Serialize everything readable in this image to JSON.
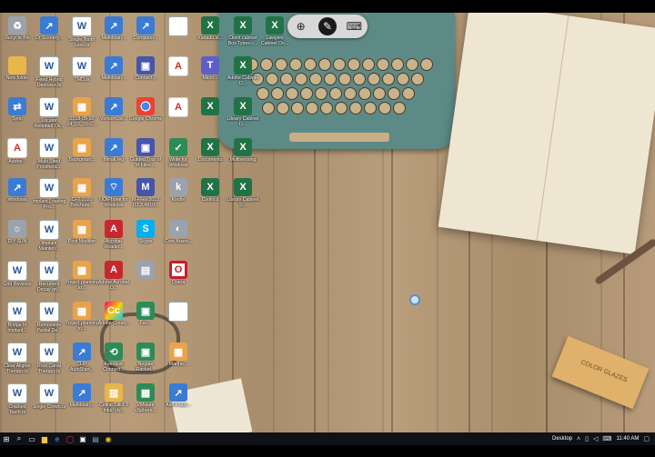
{
  "magnifier": {
    "zoom_icon": "zoom-in-icon",
    "active_icon": "magnifier-mode-icon",
    "keyboard_icon": "keyboard-icon"
  },
  "taskbar": {
    "desktop_label": "Desktop",
    "time": "11:40 AM"
  },
  "desktop_icons": [
    {
      "label": "Recycle Bin",
      "kind": "g-gray",
      "glyph": "♻"
    },
    {
      "label": "Dr Scenery...",
      "kind": "g-link",
      "glyph": "↗"
    },
    {
      "label": "Single Tooth Loss.ts",
      "kind": "g-doc",
      "glyph": "W"
    },
    {
      "label": "Meltdown...",
      "kind": "g-link",
      "glyph": "↗"
    },
    {
      "label": "Computer...",
      "kind": "g-link",
      "glyph": "↗"
    },
    {
      "label": "",
      "kind": "g-doc",
      "glyph": ""
    },
    {
      "label": "Xanadu.xl...",
      "kind": "g-xls",
      "glyph": "X"
    },
    {
      "label": "Client cabinet Box Types c...",
      "kind": "g-xls",
      "glyph": "X"
    },
    {
      "label": "Lawyers Cabinet Do...",
      "kind": "g-xls",
      "glyph": "X"
    },
    {
      "label": "New folder",
      "kind": "g-folder",
      "glyph": ""
    },
    {
      "label": "Fixed Hybrid Dentures.ts",
      "kind": "g-doc",
      "glyph": "W"
    },
    {
      "label": "TMD.ts",
      "kind": "g-doc",
      "glyph": "W"
    },
    {
      "label": "Meltdown...",
      "kind": "g-link",
      "glyph": "↗"
    },
    {
      "label": "Connect...",
      "kind": "g-app",
      "glyph": "▣"
    },
    {
      "label": "",
      "kind": "g-pdf",
      "glyph": "A"
    },
    {
      "label": "Micro...",
      "kind": "g-teams",
      "glyph": "T"
    },
    {
      "label": "Adobe Cabinet D...",
      "kind": "g-xls",
      "glyph": "X"
    },
    {
      "label": "Sync",
      "kind": "g-link",
      "glyph": "⇄"
    },
    {
      "label": "Locator Retained Ov...",
      "kind": "g-doc",
      "glyph": "W"
    },
    {
      "label": "2018-05-10 14_22_20-C...",
      "kind": "g-img",
      "glyph": "▦"
    },
    {
      "label": "VersionList...",
      "kind": "g-link",
      "glyph": "↗"
    },
    {
      "label": "Google Chrome",
      "kind": "g-chrome",
      "glyph": ""
    },
    {
      "label": "",
      "kind": "g-pdf",
      "glyph": "A"
    },
    {
      "label": "",
      "kind": "g-xls",
      "glyph": "X"
    },
    {
      "label": "Library Cabinet D...",
      "kind": "g-xls",
      "glyph": "X"
    },
    {
      "label": "Adobe...",
      "kind": "g-pdf",
      "glyph": "A"
    },
    {
      "label": "Multi Sited Prosthetic...",
      "kind": "g-doc",
      "glyph": "W"
    },
    {
      "label": "Backgroun...",
      "kind": "g-img",
      "glyph": "▦"
    },
    {
      "label": "filmail.reg",
      "kind": "g-link",
      "glyph": "↗"
    },
    {
      "label": "Guided Tour of M-Files ...",
      "kind": "g-app",
      "glyph": "▣"
    },
    {
      "label": "Write for Windows",
      "kind": "g-green",
      "glyph": "✓"
    },
    {
      "label": "Documents",
      "kind": "g-xls",
      "glyph": "X"
    },
    {
      "label": "Multisensing",
      "kind": "g-xls",
      "glyph": "X"
    },
    {
      "label": "Windows",
      "kind": "g-link",
      "glyph": "↗"
    },
    {
      "label": "Implant Loading Pro...",
      "kind": "g-doc",
      "glyph": "W"
    },
    {
      "label": "CFT 2020 Brochure...",
      "kind": "g-img",
      "glyph": "▦"
    },
    {
      "label": "NOIPhone for Windows",
      "kind": "g-link",
      "glyph": "⌔"
    },
    {
      "label": "M-Files 2018 (11.3.4810...",
      "kind": "g-app",
      "glyph": "M"
    },
    {
      "label": "Kindle",
      "kind": "g-gray",
      "glyph": "k"
    },
    {
      "label": "Coolio.x",
      "kind": "g-xls",
      "glyph": "X"
    },
    {
      "label": "Library Cabinet S...",
      "kind": "g-xls",
      "glyph": "X"
    },
    {
      "label": "DIY-SUN",
      "kind": "g-gray",
      "glyph": "☼"
    },
    {
      "label": "Implant Mainten...",
      "kind": "g-doc",
      "glyph": "W"
    },
    {
      "label": "Post Modifier",
      "kind": "g-img",
      "glyph": "▦"
    },
    {
      "label": "Acrobat Reader...",
      "kind": "g-red",
      "glyph": "A"
    },
    {
      "label": "Skype",
      "kind": "g-sky",
      "glyph": "S"
    },
    {
      "label": "Core Arsen...",
      "kind": "g-gray",
      "glyph": "◐"
    },
    {
      "label": "Grid Revision",
      "kind": "g-doc",
      "glyph": "W"
    },
    {
      "label": "Recurrent Decay an...",
      "kind": "g-doc",
      "glyph": "W"
    },
    {
      "label": "Project planning to...",
      "kind": "g-img",
      "glyph": "▦"
    },
    {
      "label": "Adobe Acrobat D...",
      "kind": "g-red",
      "glyph": "A"
    },
    {
      "label": "",
      "kind": "g-gray",
      "glyph": "▤"
    },
    {
      "label": "Opera",
      "kind": "g-opera",
      "glyph": "O"
    },
    {
      "label": "Bridge to Implant...",
      "kind": "g-doc",
      "glyph": "W"
    },
    {
      "label": "Removable Partial De...",
      "kind": "g-doc",
      "glyph": "W"
    },
    {
      "label": "Project planning to...",
      "kind": "g-img",
      "glyph": "▦"
    },
    {
      "label": "Adobe Creati...",
      "kind": "g-multi",
      "glyph": "Cc"
    },
    {
      "label": "Fax...",
      "kind": "g-green",
      "glyph": "▣"
    },
    {
      "label": "",
      "kind": "g-doc",
      "glyph": ""
    },
    {
      "label": "Clear Aligner Therapy.ts",
      "kind": "g-doc",
      "glyph": "W"
    },
    {
      "label": "Root Canal Therapy.ts",
      "kind": "g-doc",
      "glyph": "W"
    },
    {
      "label": "CLIP AutoStart...",
      "kind": "g-link",
      "glyph": "↗"
    },
    {
      "label": "Autodesk Connect...",
      "kind": "g-green",
      "glyph": "⟲"
    },
    {
      "label": "Negate Racket...",
      "kind": "g-green",
      "glyph": "▣"
    },
    {
      "label": "Marthe...",
      "kind": "g-img",
      "glyph": "▦"
    },
    {
      "label": "Cracked Teeth.ts",
      "kind": "g-doc",
      "glyph": "W"
    },
    {
      "label": "Single Crown.ts",
      "kind": "g-doc",
      "glyph": "W"
    },
    {
      "label": "Meltdown...",
      "kind": "g-link",
      "glyph": "↗"
    },
    {
      "label": "Celine Silicr 3 Intuit Hy...",
      "kind": "g-folder",
      "glyph": "▥"
    },
    {
      "label": "VMware vSphere...",
      "kind": "g-green",
      "glyph": "▦"
    },
    {
      "label": "Adminapp...",
      "kind": "g-link",
      "glyph": "↗"
    }
  ]
}
